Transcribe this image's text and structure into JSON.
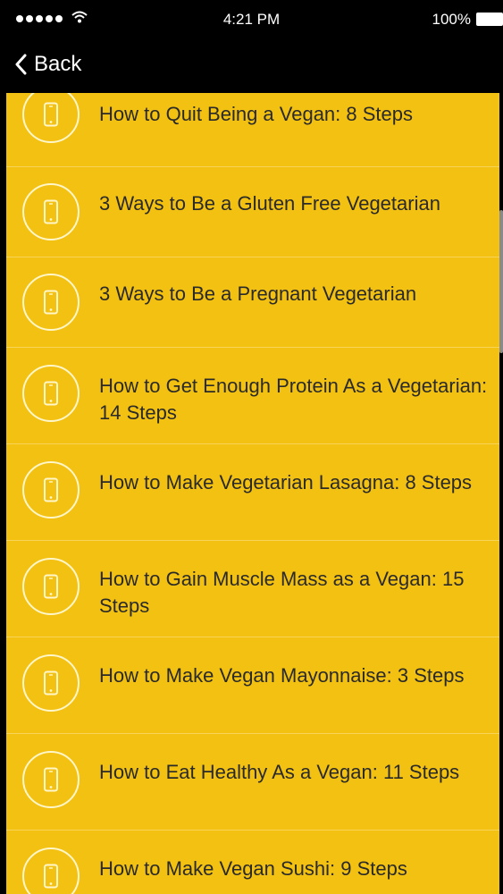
{
  "status_bar": {
    "time": "4:21 PM",
    "battery": "100%"
  },
  "nav": {
    "back_label": "Back"
  },
  "list": {
    "items": [
      {
        "title": "How to Quit Being a Vegan: 8 Steps"
      },
      {
        "title": "3 Ways to Be a Gluten Free Vegetarian"
      },
      {
        "title": "3 Ways to Be a Pregnant Vegetarian"
      },
      {
        "title": "How to Get Enough Protein As a Vegetarian: 14 Steps"
      },
      {
        "title": "How to Make Vegetarian Lasagna: 8 Steps"
      },
      {
        "title": "How to Gain Muscle Mass as a Vegan: 15 Steps"
      },
      {
        "title": "How to Make Vegan Mayonnaise: 3 Steps"
      },
      {
        "title": "How to Eat Healthy As a Vegan: 11 Steps"
      },
      {
        "title": "How to Make Vegan Sushi: 9 Steps"
      }
    ]
  },
  "colors": {
    "list_background": "#f3c111",
    "icon_ring": "#fff6c9",
    "text": "#2a2a2a"
  },
  "icons": {
    "row_icon": "smartphone-icon",
    "back_icon": "chevron-left-icon"
  }
}
